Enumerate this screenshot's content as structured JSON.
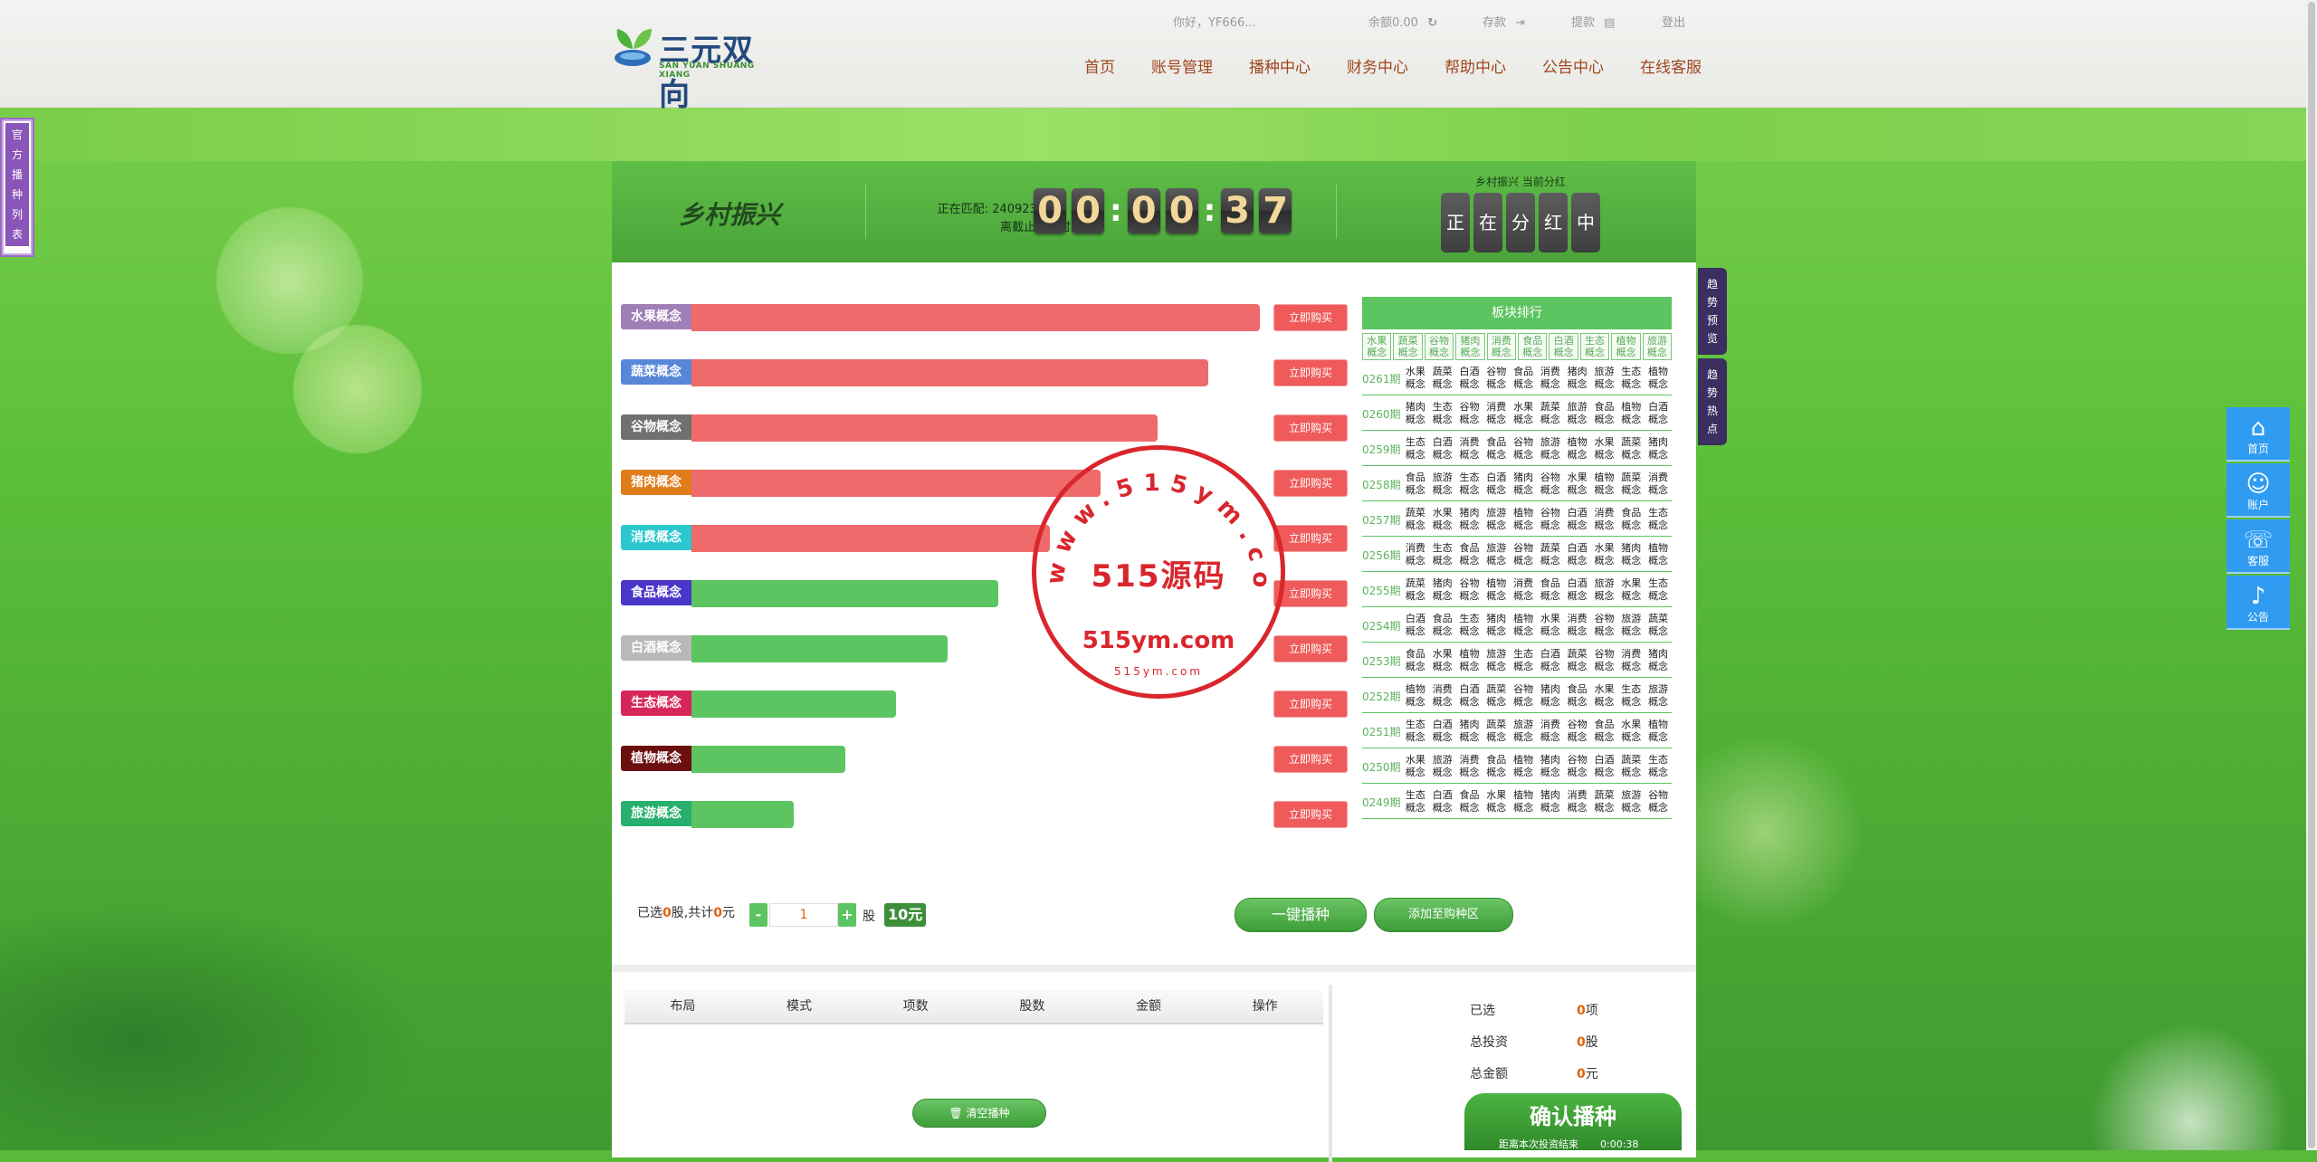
{
  "brand": {
    "name": "三元双向",
    "sub": "SAN YUAN SHUANG XIANG"
  },
  "user": {
    "greeting": "你好，YF666...",
    "balance": "余额0.00",
    "deposit": "存款",
    "withdraw": "提款",
    "logout": "登出"
  },
  "nav": [
    "首页",
    "账号管理",
    "播种中心",
    "财务中心",
    "帮助中心",
    "公告中心",
    "在线客服"
  ],
  "left_tab": "官方播种列表",
  "header": {
    "title": "乡村振兴",
    "matching": "正在匹配: 2409230167 期",
    "deadline": "离截止分红时间",
    "clock": [
      "0",
      "0",
      "0",
      "0",
      "3",
      "7"
    ],
    "status_label": "乡村振兴 当前分红",
    "status_chars": [
      "正",
      "在",
      "分",
      "红",
      "中"
    ]
  },
  "concepts": [
    {
      "label": "水果概念",
      "color": "#a07fb8",
      "bar_color": "#ef6a6a",
      "level": 1.0
    },
    {
      "label": "蔬菜概念",
      "color": "#5886d9",
      "bar_color": "#ef6a6a",
      "level": 0.91
    },
    {
      "label": "谷物概念",
      "color": "#707070",
      "bar_color": "#ef6a6a",
      "level": 0.82
    },
    {
      "label": "猪肉概念",
      "color": "#e07d1a",
      "bar_color": "#ef6a6a",
      "level": 0.72
    },
    {
      "label": "消费概念",
      "color": "#2cc7cf",
      "bar_color": "#ef6a6a",
      "level": 0.63
    },
    {
      "label": "食品概念",
      "color": "#4a36c9",
      "bar_color": "#5cc460",
      "level": 0.54
    },
    {
      "label": "白酒概念",
      "color": "#b8b8b8",
      "bar_color": "#5cc460",
      "level": 0.45
    },
    {
      "label": "生态概念",
      "color": "#d62659",
      "bar_color": "#5cc460",
      "level": 0.36
    },
    {
      "label": "植物概念",
      "color": "#6b0f0f",
      "bar_color": "#5cc460",
      "level": 0.27
    },
    {
      "label": "旅游概念",
      "color": "#27b06d",
      "bar_color": "#5cc460",
      "level": 0.18
    }
  ],
  "buy_label": "立即购买",
  "ranking": {
    "title": "板块排行",
    "categories": [
      "水果概念",
      "蔬菜概念",
      "谷物概念",
      "猪肉概念",
      "消费概念",
      "食品概念",
      "白酒概念",
      "生态概念",
      "植物概念",
      "旅游概念"
    ],
    "rows": [
      {
        "no": "0261期",
        "items": [
          "水果概念",
          "蔬菜概念",
          "白酒概念",
          "谷物概念",
          "食品概念",
          "消费概念",
          "猪肉概念",
          "旅游概念",
          "生态概念",
          "植物概念"
        ]
      },
      {
        "no": "0260期",
        "items": [
          "猪肉概念",
          "生态概念",
          "谷物概念",
          "消费概念",
          "水果概念",
          "蔬菜概念",
          "旅游概念",
          "食品概念",
          "植物概念",
          "白酒概念"
        ]
      },
      {
        "no": "0259期",
        "items": [
          "生态概念",
          "白酒概念",
          "消费概念",
          "食品概念",
          "谷物概念",
          "旅游概念",
          "植物概念",
          "水果概念",
          "蔬菜概念",
          "猪肉概念"
        ]
      },
      {
        "no": "0258期",
        "items": [
          "食品概念",
          "旅游概念",
          "生态概念",
          "白酒概念",
          "猪肉概念",
          "谷物概念",
          "水果概念",
          "植物概念",
          "蔬菜概念",
          "消费概念"
        ]
      },
      {
        "no": "0257期",
        "items": [
          "蔬菜概念",
          "水果概念",
          "猪肉概念",
          "旅游概念",
          "植物概念",
          "谷物概念",
          "白酒概念",
          "消费概念",
          "食品概念",
          "生态概念"
        ]
      },
      {
        "no": "0256期",
        "items": [
          "消费概念",
          "生态概念",
          "食品概念",
          "旅游概念",
          "谷物概念",
          "蔬菜概念",
          "白酒概念",
          "水果概念",
          "猪肉概念",
          "植物概念"
        ]
      },
      {
        "no": "0255期",
        "items": [
          "蔬菜概念",
          "猪肉概念",
          "谷物概念",
          "植物概念",
          "消费概念",
          "食品概念",
          "白酒概念",
          "旅游概念",
          "水果概念",
          "生态概念"
        ]
      },
      {
        "no": "0254期",
        "items": [
          "白酒概念",
          "食品概念",
          "生态概念",
          "猪肉概念",
          "植物概念",
          "水果概念",
          "消费概念",
          "谷物概念",
          "旅游概念",
          "蔬菜概念"
        ]
      },
      {
        "no": "0253期",
        "items": [
          "食品概念",
          "水果概念",
          "植物概念",
          "旅游概念",
          "生态概念",
          "白酒概念",
          "蔬菜概念",
          "谷物概念",
          "消费概念",
          "猪肉概念"
        ]
      },
      {
        "no": "0252期",
        "items": [
          "植物概念",
          "消费概念",
          "白酒概念",
          "蔬菜概念",
          "谷物概念",
          "猪肉概念",
          "食品概念",
          "水果概念",
          "生态概念",
          "旅游概念"
        ]
      },
      {
        "no": "0251期",
        "items": [
          "生态概念",
          "白酒概念",
          "猪肉概念",
          "蔬菜概念",
          "旅游概念",
          "消费概念",
          "谷物概念",
          "食品概念",
          "水果概念",
          "植物概念"
        ]
      },
      {
        "no": "0250期",
        "items": [
          "水果概念",
          "旅游概念",
          "消费概念",
          "食品概念",
          "植物概念",
          "猪肉概念",
          "谷物概念",
          "白酒概念",
          "蔬菜概念",
          "生态概念"
        ]
      },
      {
        "no": "0249期",
        "items": [
          "生态概念",
          "白酒概念",
          "食品概念",
          "水果概念",
          "植物概念",
          "猪肉概念",
          "消费概念",
          "蔬菜概念",
          "旅游概念",
          "谷物概念"
        ]
      }
    ]
  },
  "stamp": {
    "ring": "www.515ym.com",
    "big": "515源码",
    "url": "515ym.com",
    "small": "515ym.com"
  },
  "controls": {
    "selected_pre": "已选",
    "selected_count": "0",
    "selected_mid": "股,共计",
    "total": "0",
    "selected_suf": "元",
    "minus": "-",
    "plus": "+",
    "qty": "1",
    "unit": "股",
    "price": "10元",
    "seed_one": "一键播种",
    "add_cart": "添加至购种区"
  },
  "table": {
    "headers": [
      "布局",
      "模式",
      "项数",
      "股数",
      "金额",
      "操作"
    ],
    "clear": "清空播种"
  },
  "summary": {
    "selected_label": "已选",
    "selected_value": "0",
    "selected_unit": "项",
    "invest_label": "总投资",
    "invest_value": "0",
    "invest_unit": "股",
    "amount_label": "总金额",
    "amount_value": "0",
    "amount_unit": "元"
  },
  "confirm": {
    "title": "确认播种",
    "remain": "距离本次投资结束",
    "time": "0:00:38"
  },
  "right_tabs": [
    "趋势预览",
    "趋势热点"
  ],
  "widgets": [
    {
      "label": "首页",
      "icon": "home-icon"
    },
    {
      "label": "账户",
      "icon": "user-icon"
    },
    {
      "label": "客服",
      "icon": "headset-icon"
    },
    {
      "label": "公告",
      "icon": "bell-icon"
    }
  ],
  "colors": {
    "accent_green": "#5cc460",
    "buy_red": "#ef5a5a",
    "nav_brown": "#a0461c",
    "widget_blue": "#2f9cf2"
  }
}
